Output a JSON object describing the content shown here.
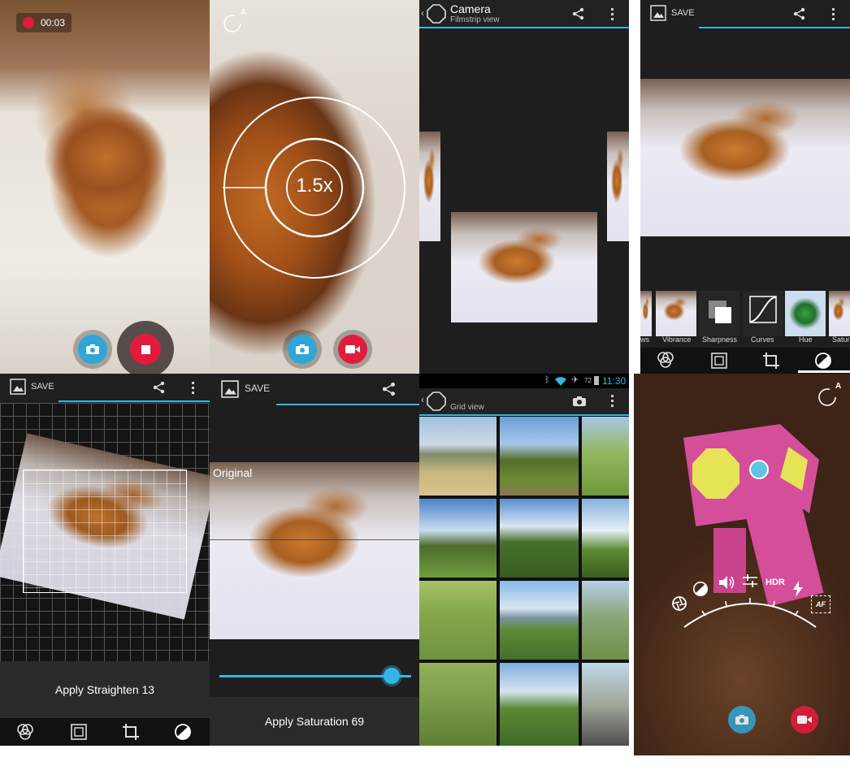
{
  "colors": {
    "accent": "#33b5e5",
    "record": "#e21b3c",
    "camera_btn": "#2fa6d6",
    "bar_bg": "#1f1f1f"
  },
  "p1": {
    "rec_time": "00:03"
  },
  "p2": {
    "zoom": "1.5x",
    "flash_mode": "A"
  },
  "p3": {
    "app_title": "Camera",
    "view_mode": "Filmstrip view"
  },
  "p4": {
    "save_label": "SAVE",
    "filters": [
      {
        "label": "ws"
      },
      {
        "label": "Vibrance"
      },
      {
        "label": "Sharpness"
      },
      {
        "label": "Curves"
      },
      {
        "label": "Hue"
      },
      {
        "label": "Saturat"
      }
    ]
  },
  "p5": {
    "save_label": "SAVE",
    "apply_text": "Apply Straighten 13"
  },
  "p6": {
    "save_label": "SAVE",
    "original_label": "Original",
    "apply_text": "Apply Saturation 69",
    "slider_value": 0.9
  },
  "p7": {
    "clock": "11:30",
    "battery": "72",
    "view_mode": "Grid view"
  },
  "p8": {
    "flash_mode": "A",
    "hdr_label": "HDR",
    "af_label": "AF"
  },
  "icons": [
    "record-dot-icon",
    "stop-icon",
    "camera-icon",
    "video-camera-icon",
    "share-icon",
    "overflow-menu-icon",
    "back-chevron-icon",
    "gallery-icon",
    "filters-icon",
    "frame-icon",
    "crop-icon",
    "exposure-icon",
    "bluetooth-icon",
    "wifi-icon",
    "airplane-icon",
    "battery-icon",
    "aperture-icon",
    "volume-icon",
    "sliders-icon",
    "flash-auto-icon"
  ]
}
